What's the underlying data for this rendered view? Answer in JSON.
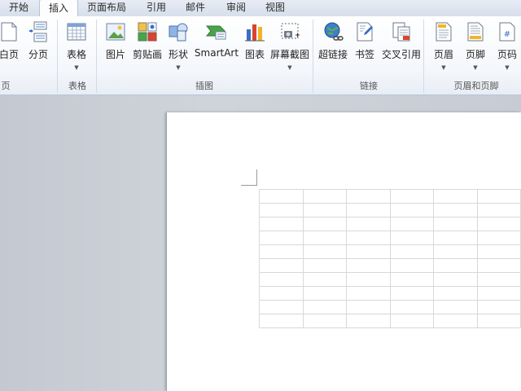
{
  "tabs": [
    {
      "label": "开始",
      "active": false
    },
    {
      "label": "插入",
      "active": true
    },
    {
      "label": "页面布局",
      "active": false
    },
    {
      "label": "引用",
      "active": false
    },
    {
      "label": "邮件",
      "active": false
    },
    {
      "label": "审阅",
      "active": false
    },
    {
      "label": "视图",
      "active": false
    }
  ],
  "ribbon": {
    "pages": {
      "blank_page": "白页",
      "page_break": "分页",
      "group": "页"
    },
    "tables": {
      "table": "表格",
      "group": "表格"
    },
    "illustrations": {
      "picture": "图片",
      "clipart": "剪贴画",
      "shapes": "形状",
      "smartart": "SmartArt",
      "chart": "图表",
      "screenshot": "屏幕截图",
      "group": "插图"
    },
    "links": {
      "hyperlink": "超链接",
      "bookmark": "书签",
      "cross_reference": "交叉引用",
      "group": "链接"
    },
    "header_footer": {
      "header": "页眉",
      "footer": "页脚",
      "page_number": "页码",
      "group": "页眉和页脚"
    }
  },
  "icons": [
    "blank-page-icon",
    "page-break-icon",
    "table-icon",
    "picture-icon",
    "clipart-icon",
    "shapes-icon",
    "smartart-icon",
    "chart-icon",
    "screenshot-icon",
    "hyperlink-icon",
    "bookmark-icon",
    "cross-reference-icon",
    "header-icon",
    "footer-icon",
    "page-number-icon"
  ],
  "document": {
    "table": {
      "rows": 10,
      "columns": 6
    }
  },
  "colors": {
    "ribbon_bg": "#f4f7fb",
    "tab_bar": "#dfe6f0",
    "workspace": "#c9ced6",
    "page": "#ffffff",
    "chart_blue": "#3a6fc4",
    "chart_red": "#d8452f",
    "chart_yellow": "#f2b42a",
    "smartart_green": "#4aa44a"
  }
}
